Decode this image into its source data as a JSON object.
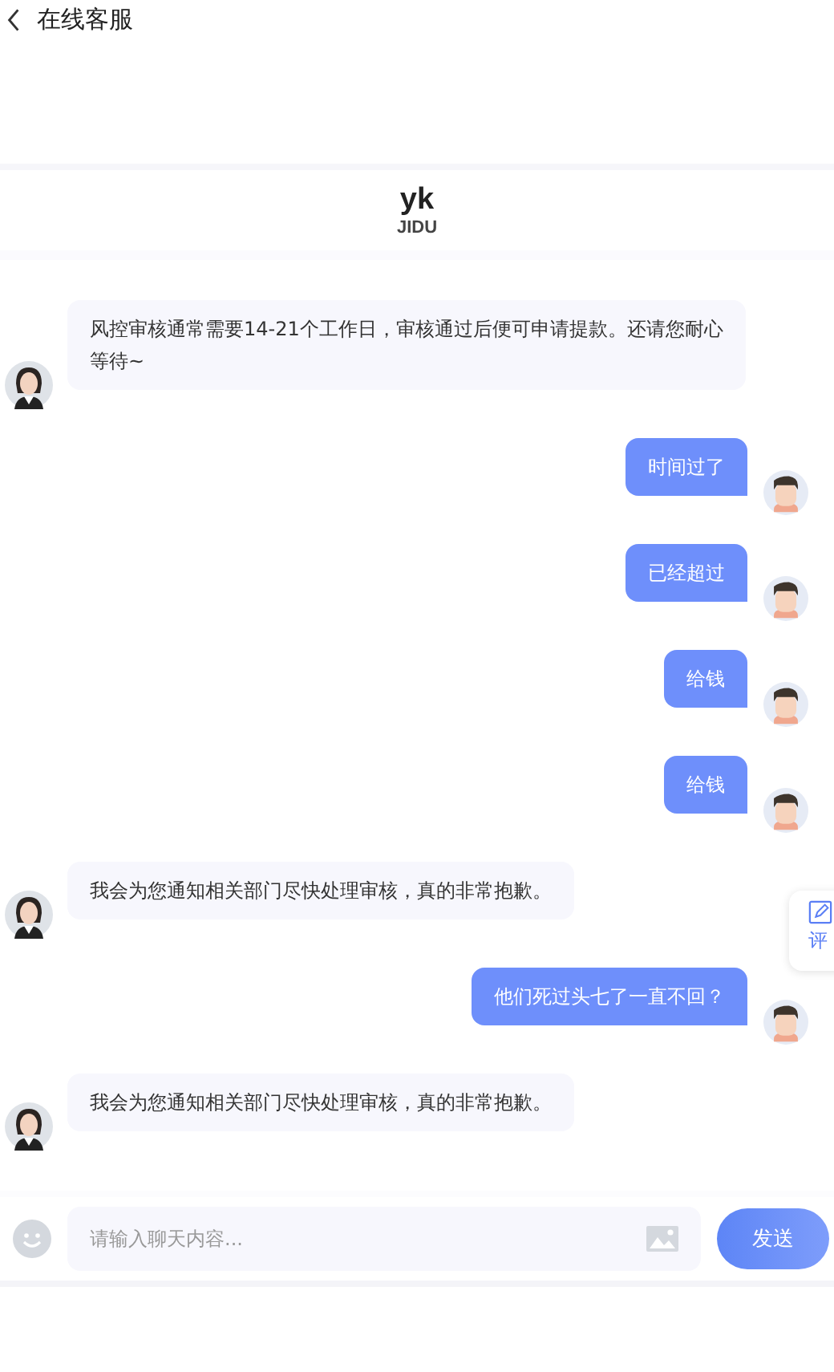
{
  "top_bar": {
    "title": "在线客服"
  },
  "header": {
    "name": "yk",
    "subtitle": "JIDU"
  },
  "messages": [
    {
      "kind": "agent",
      "text": "风控审核通常需要14-21个工作日，审核通过后便可申请提款。还请您耐心等待~"
    },
    {
      "kind": "user",
      "text": "时间过了"
    },
    {
      "kind": "user",
      "text": "已经超过"
    },
    {
      "kind": "user",
      "text": "给钱"
    },
    {
      "kind": "user",
      "text": "给钱"
    },
    {
      "kind": "agent",
      "text": "我会为您通知相关部门尽快处理审核，真的非常抱歉。"
    },
    {
      "kind": "user",
      "text": "他们死过头七了一直不回？"
    },
    {
      "kind": "agent",
      "text": "我会为您通知相关部门尽快处理审核，真的非常抱歉。"
    }
  ],
  "rate_tab": {
    "label": "评"
  },
  "composer": {
    "placeholder": "请输入聊天内容...",
    "send": "发送"
  }
}
